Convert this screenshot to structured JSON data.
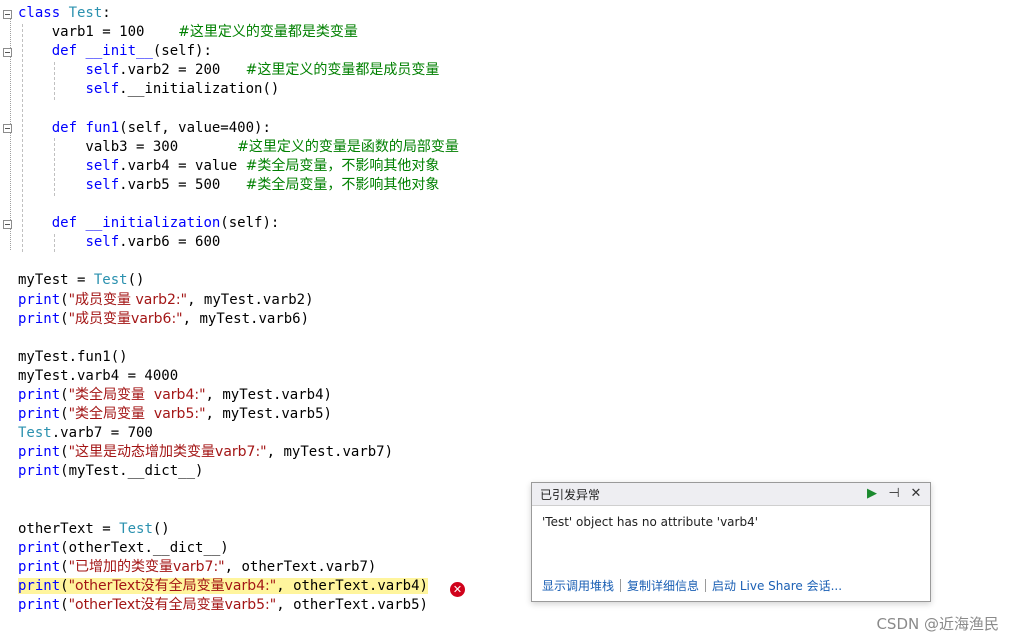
{
  "code": {
    "lines": [
      {
        "parts": [
          {
            "t": "class ",
            "c": "kw"
          },
          {
            "t": "Test",
            "c": "cls"
          },
          {
            "t": ":",
            "c": ""
          }
        ]
      },
      {
        "parts": [
          {
            "t": "    varb1 = 100    ",
            "c": ""
          },
          {
            "t": "#这里定义的变量都是类变量",
            "c": "cmt"
          }
        ]
      },
      {
        "parts": [
          {
            "t": "    def ",
            "c": "kw"
          },
          {
            "t": "__init__",
            "c": "fn"
          },
          {
            "t": "(self):",
            "c": ""
          }
        ]
      },
      {
        "parts": [
          {
            "t": "        ",
            "c": ""
          },
          {
            "t": "self",
            "c": "kw"
          },
          {
            "t": ".varb2 = 200   ",
            "c": ""
          },
          {
            "t": "#这里定义的变量都是成员变量",
            "c": "cmt"
          }
        ]
      },
      {
        "parts": [
          {
            "t": "        ",
            "c": ""
          },
          {
            "t": "self",
            "c": "kw"
          },
          {
            "t": ".__initialization()",
            "c": ""
          }
        ]
      },
      {
        "parts": [
          {
            "t": "",
            "c": ""
          }
        ]
      },
      {
        "parts": [
          {
            "t": "    def ",
            "c": "kw"
          },
          {
            "t": "fun1",
            "c": "fn"
          },
          {
            "t": "(self, value=400):",
            "c": ""
          }
        ]
      },
      {
        "parts": [
          {
            "t": "        valb3 = 300       ",
            "c": ""
          },
          {
            "t": "#这里定义的变量是函数的局部变量",
            "c": "cmt"
          }
        ]
      },
      {
        "parts": [
          {
            "t": "        ",
            "c": ""
          },
          {
            "t": "self",
            "c": "kw"
          },
          {
            "t": ".varb4 = value ",
            "c": ""
          },
          {
            "t": "#类全局变量，不影响其他对象",
            "c": "cmt"
          }
        ]
      },
      {
        "parts": [
          {
            "t": "        ",
            "c": ""
          },
          {
            "t": "self",
            "c": "kw"
          },
          {
            "t": ".varb5 = 500   ",
            "c": ""
          },
          {
            "t": "#类全局变量，不影响其他对象",
            "c": "cmt"
          }
        ]
      },
      {
        "parts": [
          {
            "t": "",
            "c": ""
          }
        ]
      },
      {
        "parts": [
          {
            "t": "    def ",
            "c": "kw"
          },
          {
            "t": "__initialization",
            "c": "fn"
          },
          {
            "t": "(self):",
            "c": ""
          }
        ]
      },
      {
        "parts": [
          {
            "t": "        ",
            "c": ""
          },
          {
            "t": "self",
            "c": "kw"
          },
          {
            "t": ".varb6 = 600",
            "c": ""
          }
        ]
      },
      {
        "parts": [
          {
            "t": "",
            "c": ""
          }
        ]
      },
      {
        "parts": [
          {
            "t": "myTest = ",
            "c": ""
          },
          {
            "t": "Test",
            "c": "cls"
          },
          {
            "t": "()",
            "c": ""
          }
        ]
      },
      {
        "parts": [
          {
            "t": "print",
            "c": "fn"
          },
          {
            "t": "(",
            "c": ""
          },
          {
            "t": "\"成员变量 varb2:\"",
            "c": "str"
          },
          {
            "t": ", myTest.varb2)",
            "c": ""
          }
        ]
      },
      {
        "parts": [
          {
            "t": "print",
            "c": "fn"
          },
          {
            "t": "(",
            "c": ""
          },
          {
            "t": "\"成员变量varb6:\"",
            "c": "str"
          },
          {
            "t": ", myTest.varb6)",
            "c": ""
          }
        ]
      },
      {
        "parts": [
          {
            "t": "",
            "c": ""
          }
        ]
      },
      {
        "parts": [
          {
            "t": "myTest.fun1()",
            "c": ""
          }
        ]
      },
      {
        "parts": [
          {
            "t": "myTest.varb4 = 4000",
            "c": ""
          }
        ]
      },
      {
        "parts": [
          {
            "t": "print",
            "c": "fn"
          },
          {
            "t": "(",
            "c": ""
          },
          {
            "t": "\"类全局变量  varb4:\"",
            "c": "str"
          },
          {
            "t": ", myTest.varb4)",
            "c": ""
          }
        ]
      },
      {
        "parts": [
          {
            "t": "print",
            "c": "fn"
          },
          {
            "t": "(",
            "c": ""
          },
          {
            "t": "\"类全局变量  varb5:\"",
            "c": "str"
          },
          {
            "t": ", myTest.varb5)",
            "c": ""
          }
        ]
      },
      {
        "parts": [
          {
            "t": "Test",
            "c": "cls"
          },
          {
            "t": ".varb7 = 700",
            "c": ""
          }
        ]
      },
      {
        "parts": [
          {
            "t": "print",
            "c": "fn"
          },
          {
            "t": "(",
            "c": ""
          },
          {
            "t": "\"这里是动态增加类变量varb7:\"",
            "c": "str"
          },
          {
            "t": ", myTest.varb7)",
            "c": ""
          }
        ]
      },
      {
        "parts": [
          {
            "t": "print",
            "c": "fn"
          },
          {
            "t": "(myTest.__dict__)",
            "c": ""
          }
        ]
      },
      {
        "parts": [
          {
            "t": "",
            "c": ""
          }
        ]
      },
      {
        "parts": [
          {
            "t": "",
            "c": ""
          }
        ]
      },
      {
        "parts": [
          {
            "t": "otherText = ",
            "c": ""
          },
          {
            "t": "Test",
            "c": "cls"
          },
          {
            "t": "()",
            "c": ""
          }
        ]
      },
      {
        "parts": [
          {
            "t": "print",
            "c": "fn"
          },
          {
            "t": "(otherText.__dict__)",
            "c": ""
          }
        ]
      },
      {
        "parts": [
          {
            "t": "print",
            "c": "fn"
          },
          {
            "t": "(",
            "c": ""
          },
          {
            "t": "\"已增加的类变量varb7:\"",
            "c": "str"
          },
          {
            "t": ", otherText.varb7)",
            "c": ""
          }
        ]
      },
      {
        "parts": [
          {
            "t": "print",
            "c": "fn"
          },
          {
            "t": "(",
            "c": ""
          },
          {
            "t": "\"otherText没有全局变量varb4:\"",
            "c": "str"
          },
          {
            "t": ", otherText.varb4)",
            "c": ""
          }
        ],
        "highlight": true
      },
      {
        "parts": [
          {
            "t": "print",
            "c": "fn"
          },
          {
            "t": "(",
            "c": ""
          },
          {
            "t": "\"otherText没有全局变量varb5:\"",
            "c": "str"
          },
          {
            "t": ", otherText.varb5)",
            "c": ""
          }
        ]
      }
    ]
  },
  "error_icon": "error-x-icon",
  "exception_popup": {
    "title": "已引发异常",
    "message": "'Test' object has no attribute 'varb4'",
    "links": [
      "显示调用堆栈",
      "复制详细信息",
      "启动 Live Share 会话..."
    ],
    "buttons": {
      "continue": "▶",
      "pin": "⊣",
      "close": "✕"
    }
  },
  "watermark": "CSDN @近海渔民",
  "colors": {
    "keyword": "#0000ff",
    "class": "#2b91af",
    "comment": "#008000",
    "string": "#a31515",
    "highlight": "#fff59d",
    "error": "#d0021b"
  }
}
